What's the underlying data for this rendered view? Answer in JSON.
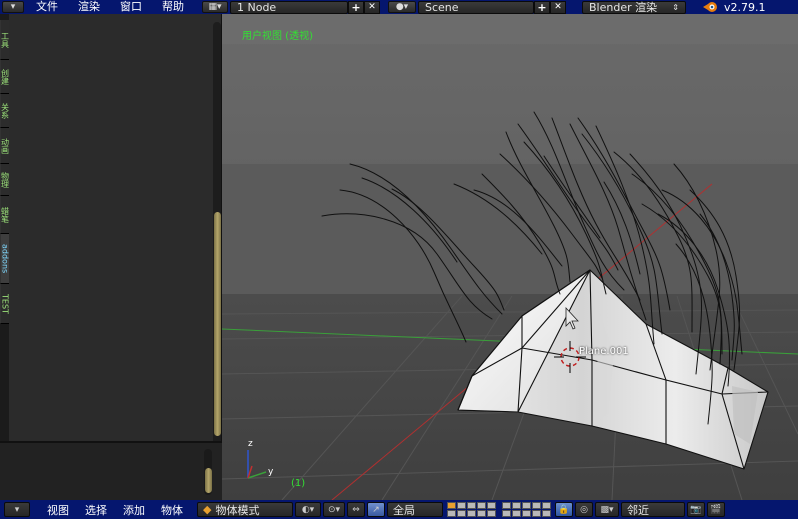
{
  "topbar": {
    "menus": [
      "文件",
      "渲染",
      "窗口",
      "帮助"
    ],
    "screen_layout": "1 Node",
    "scene": "Scene",
    "render_engine": "Blender 渲染",
    "version": "v2.79.1",
    "add_glyph": "+",
    "close_glyph": "✕"
  },
  "tabs": [
    "工具",
    "创建",
    "关系",
    "动画",
    "物理",
    "蜡笔",
    "addons",
    "TEST"
  ],
  "active_tab": "addons",
  "viewport": {
    "title": "用户视图 (透视)",
    "frame": "(1)",
    "object_name": "Plane.001",
    "colors": {
      "background_top": "#5e5e5e",
      "grid_floor": "#444444",
      "x_axis": "#b03030",
      "y_axis": "#3aa03a"
    }
  },
  "bottombar": {
    "menus": [
      "视图",
      "选择",
      "添加",
      "物体"
    ],
    "mode": "物体模式",
    "pivot": "全局",
    "snap": "邻近"
  },
  "icons": [
    "blender-logo-icon",
    "layout-icon",
    "scene-icon",
    "editor-type-icon",
    "viewport-shading-icon",
    "pivot-icon",
    "manipulator-icon",
    "transform-orientation-icon",
    "lock-icon",
    "snap-icon",
    "render-icon",
    "anim-render-icon"
  ]
}
